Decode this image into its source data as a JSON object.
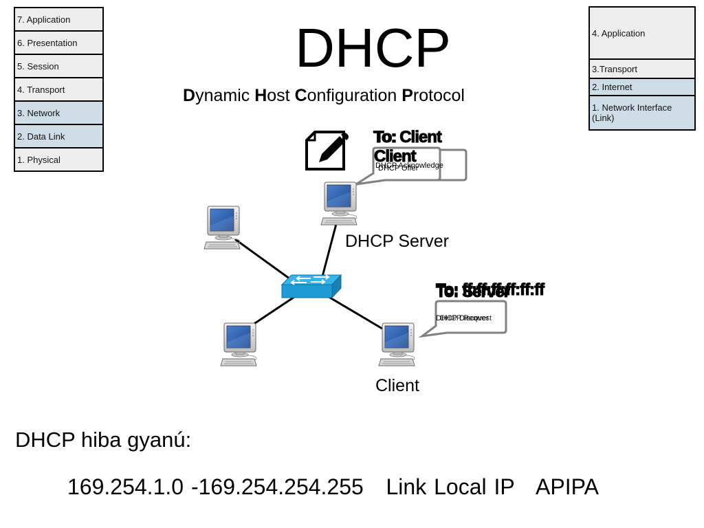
{
  "osi_model": {
    "layers": [
      {
        "label": "7. Application",
        "highlighted": false
      },
      {
        "label": "6. Presentation",
        "highlighted": false
      },
      {
        "label": "5. Session",
        "highlighted": false
      },
      {
        "label": "4. Transport",
        "highlighted": false
      },
      {
        "label": "3. Network",
        "highlighted": true
      },
      {
        "label": "2. Data Link",
        "highlighted": true
      },
      {
        "label": "1. Physical",
        "highlighted": false
      }
    ]
  },
  "tcpip_model": {
    "layers": [
      {
        "label": "4. Application",
        "highlighted": false
      },
      {
        "label": "3.Transport",
        "highlighted": false
      },
      {
        "label": "2. Internet",
        "highlighted": true
      },
      {
        "label": "1. Network Interface (Link)",
        "highlighted": true
      }
    ]
  },
  "header": {
    "title": "DHCP",
    "subtitle_parts": [
      {
        "text": "D",
        "bold": true
      },
      {
        "text": "ynamic ",
        "bold": false
      },
      {
        "text": "H",
        "bold": true
      },
      {
        "text": "ost ",
        "bold": false
      },
      {
        "text": "C",
        "bold": true
      },
      {
        "text": "onfiguration ",
        "bold": false
      },
      {
        "text": "P",
        "bold": true
      },
      {
        "text": "rotocol",
        "bold": false
      }
    ]
  },
  "diagram": {
    "edit_icon": "edit-document-icon",
    "server": {
      "label": "DHCP Server",
      "to_labels": [
        "To: Client",
        "To: Client"
      ],
      "messages": [
        "DHCP Offer",
        "DHCP Acknowledge"
      ]
    },
    "client": {
      "label": "Client",
      "to_labels": [
        "To: Server",
        "To: ff:ff:ff:ff:ff:ff"
      ],
      "messages": [
        "DHCP Discover",
        "DHCP Request"
      ]
    },
    "switch_icon": "network-switch-icon",
    "computer_icon": "desktop-computer-icon",
    "colors": {
      "switch": "#1f9ad6",
      "screen": "#2f5fa8",
      "bubble_border": "#808080"
    }
  },
  "footer": {
    "heading": "DHCP hiba gyanú:",
    "range": "169.254.1.0 -169.254.254.255",
    "link_local": "Link Local IP",
    "apipa": "APIPA"
  }
}
